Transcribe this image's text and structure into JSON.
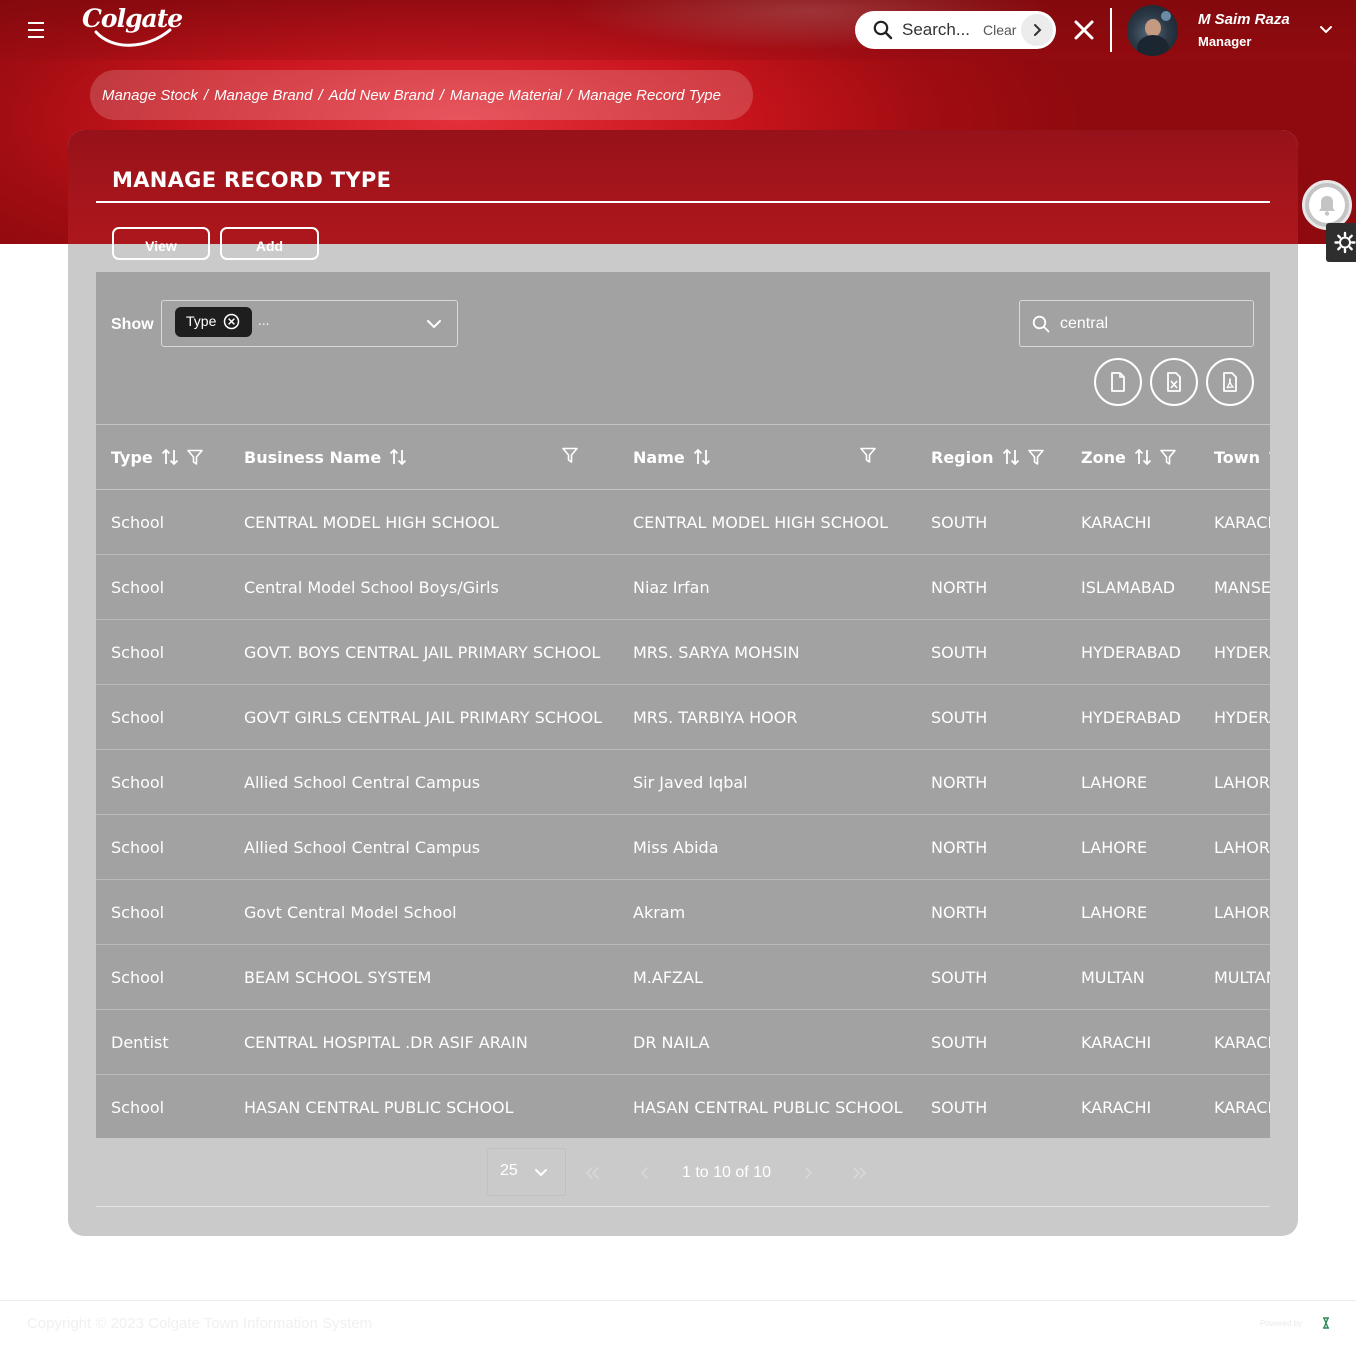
{
  "header": {
    "logo": "Colgate",
    "search": {
      "placeholder": "Search...",
      "clear": "Clear"
    },
    "user": {
      "name": "M Saim Raza",
      "role": "Manager"
    }
  },
  "breadcrumb": [
    "Manage Stock",
    "Manage Brand",
    "Add New Brand",
    "Manage Material",
    "Manage Record Type"
  ],
  "page": {
    "title": "MANAGE RECORD TYPE",
    "buttons": {
      "view": "View",
      "add": "Add"
    }
  },
  "filters": {
    "show_label": "Show",
    "chip": "Type",
    "ellipsis": "...",
    "search_value": "central"
  },
  "table": {
    "columns": [
      "Type",
      "Business Name",
      "Name",
      "Region",
      "Zone",
      "Town"
    ],
    "rows": [
      [
        "School",
        "CENTRAL MODEL HIGH SCHOOL",
        "CENTRAL MODEL HIGH SCHOOL",
        "SOUTH",
        "KARACHI",
        "KARACHI"
      ],
      [
        "School",
        "Central Model School Boys/Girls",
        "Niaz Irfan",
        "NORTH",
        "ISLAMABAD",
        "MANSEHRA"
      ],
      [
        "School",
        "GOVT. BOYS CENTRAL JAIL PRIMARY SCHOOL",
        "MRS. SARYA MOHSIN",
        "SOUTH",
        "HYDERABAD",
        "HYDERABAD"
      ],
      [
        "School",
        "GOVT GIRLS CENTRAL JAIL PRIMARY SCHOOL",
        "MRS. TARBIYA HOOR",
        "SOUTH",
        "HYDERABAD",
        "HYDERABAD"
      ],
      [
        "School",
        "Allied School Central Campus",
        "Sir Javed Iqbal",
        "NORTH",
        "LAHORE",
        "LAHORE"
      ],
      [
        "School",
        "Allied School Central Campus",
        "Miss Abida",
        "NORTH",
        "LAHORE",
        "LAHORE"
      ],
      [
        "School",
        "Govt Central Model School",
        "Akram",
        "NORTH",
        "LAHORE",
        "LAHORE"
      ],
      [
        "School",
        "BEAM SCHOOL SYSTEM",
        "M.AFZAL",
        "SOUTH",
        "MULTAN",
        "MULTAN"
      ],
      [
        "Dentist",
        "CENTRAL HOSPITAL .DR ASIF ARAIN",
        "DR NAILA",
        "SOUTH",
        "KARACHI",
        "KARACHI"
      ],
      [
        "School",
        "HASAN CENTRAL PUBLIC SCHOOL",
        "HASAN CENTRAL PUBLIC SCHOOL",
        "SOUTH",
        "KARACHI",
        "KARACHI"
      ]
    ]
  },
  "pagination": {
    "page_size": "25",
    "info": "1 to 10 of 10"
  },
  "footer": {
    "copyright": "Copyright © 2023 Colgate Town Information System",
    "powered_by": "Powered by"
  },
  "colors": {
    "brand_red": "#c8141c",
    "panel_grey": "#cacaca",
    "table_grey": "#a2a2a2"
  },
  "icons": {
    "menu": "hamburger-icon",
    "search": "search-icon",
    "close": "close-icon",
    "notification": "bell-icon",
    "settings": "gear-icon",
    "exports": [
      "file-icon",
      "excel-icon",
      "pdf-icon"
    ]
  }
}
